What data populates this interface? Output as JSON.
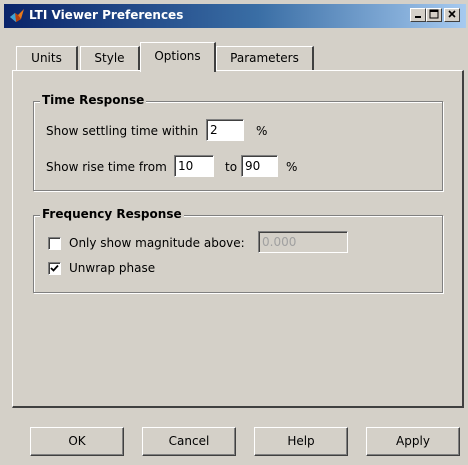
{
  "window": {
    "title": "LTI Viewer Preferences",
    "icon": "matlab-icon"
  },
  "title_controls": {
    "minimize": "minimize-icon",
    "maximize": "maximize-icon",
    "close": "close-icon"
  },
  "tabs": [
    {
      "label": "Units",
      "active": false
    },
    {
      "label": "Style",
      "active": false
    },
    {
      "label": "Options",
      "active": true
    },
    {
      "label": "Parameters",
      "active": false
    }
  ],
  "time_response": {
    "title": "Time Response",
    "settling_label": "Show settling time within",
    "settling_value": "2",
    "settling_unit": "%",
    "rise_label": "Show rise time from",
    "rise_from": "10",
    "rise_to_label": "to",
    "rise_to": "90",
    "rise_unit": "%"
  },
  "frequency_response": {
    "title": "Frequency Response",
    "magnitude_label": "Only show magnitude above:",
    "magnitude_checked": false,
    "magnitude_value": "0.000",
    "unwrap_label": "Unwrap phase",
    "unwrap_checked": true
  },
  "buttons": {
    "ok": "OK",
    "cancel": "Cancel",
    "help": "Help",
    "apply": "Apply"
  }
}
